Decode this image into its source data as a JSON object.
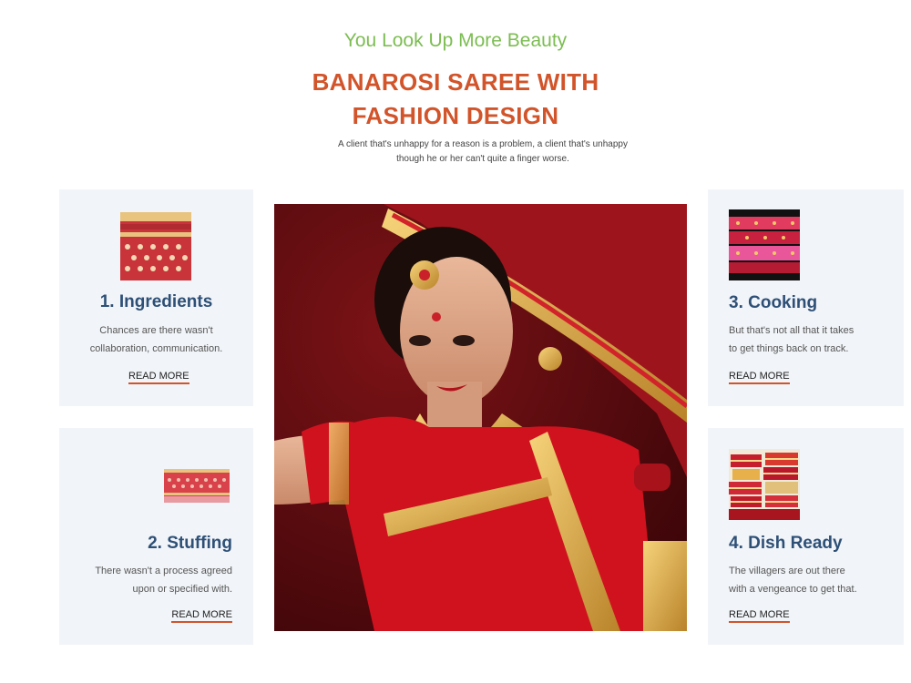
{
  "section": {
    "kicker": "You Look Up More Beauty",
    "title_line1": "BANAROSI SAREE WITH",
    "title_line2": "FASHION DESIGN",
    "subtitle_line1": "A client that's unhappy for a reason is a problem, a client that's unhappy",
    "subtitle_line2": "though he or her can't quite a finger worse."
  },
  "cards": [
    {
      "title": "1. Ingredients",
      "text_line1": "Chances are there wasn't",
      "text_line2": "collaboration, communication.",
      "link": "READ MORE",
      "thumb_icon": "saree-fabric-image"
    },
    {
      "title": "2. Stuffing",
      "text_line1": "There wasn't a process agreed",
      "text_line2": "upon or specified with.",
      "link": "READ MORE",
      "thumb_icon": "saree-fabric-image"
    },
    {
      "title": "3. Cooking",
      "text_line1": "But that's not all that it takes",
      "text_line2": "to get things back on track.",
      "link": "READ MORE",
      "thumb_icon": "saree-fabric-image"
    },
    {
      "title": "4. Dish Ready",
      "text_line1": "The villagers are out there",
      "text_line2": "with a vengeance to get that.",
      "link": "READ MORE",
      "thumb_icon": "saree-stack-image"
    }
  ],
  "colors": {
    "kicker": "#7cbd52",
    "title": "#d2542a",
    "card_title": "#2e5077",
    "card_bg": "#f1f4f8",
    "link_underline": "#d2542a"
  }
}
